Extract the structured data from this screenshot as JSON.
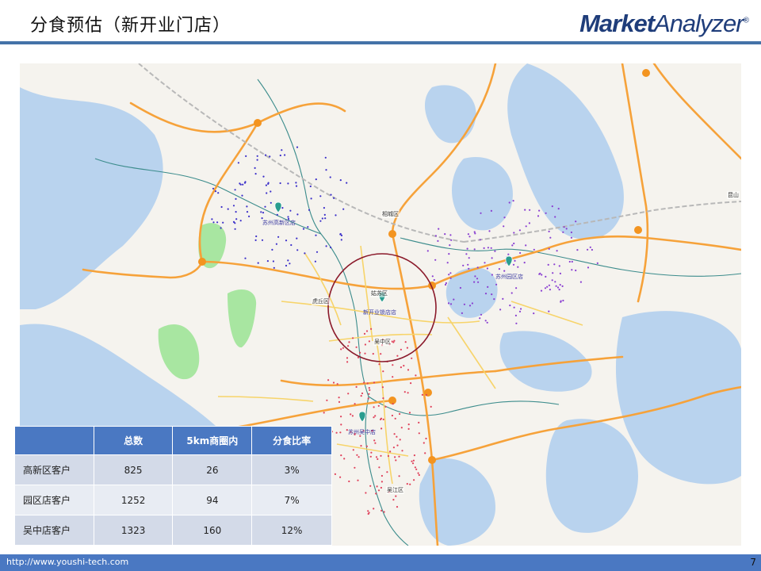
{
  "slide": {
    "title": "分食预估（新开业门店）",
    "logo_bold": "Market",
    "logo_rest": "Analyzer",
    "logo_mark": "®"
  },
  "map": {
    "stores": [
      {
        "label": "苏州高新区店",
        "color": "#2a9d8f"
      },
      {
        "label": "苏州园区店",
        "color": "#2a9d8f"
      },
      {
        "label": "新开业锁店店",
        "color": "#2a9d8f"
      },
      {
        "label": "苏州吴中店",
        "color": "#2a9d8f"
      }
    ],
    "districts": [
      "姑苏区",
      "虎丘区",
      "吴中区",
      "相城区",
      "吴江区",
      "昆山"
    ],
    "colors": {
      "water": "#b9d3ee",
      "land": "#f5f3ee",
      "park": "#a8e6a1",
      "highway": "#f6a23a",
      "arterial": "#f7d46a",
      "boundary": "#3c8c8c",
      "ring": "#8b1a2b",
      "gaoxin_customers": "#3b2fc9",
      "yuanqu_customers": "#8a3fd1",
      "wuzhong_customers": "#e0405a"
    }
  },
  "table": {
    "headers": [
      "",
      "总数",
      "5km商圈内",
      "分食比率"
    ],
    "rows": [
      {
        "name": "高新区客户",
        "total": "825",
        "in5km": "26",
        "ratio": "3%"
      },
      {
        "name": "园区店客户",
        "total": "1252",
        "in5km": "94",
        "ratio": "7%"
      },
      {
        "name": "吴中店客户",
        "total": "1323",
        "in5km": "160",
        "ratio": "12%"
      }
    ]
  },
  "footer": {
    "url": "http://www.youshi-tech.com",
    "page": "7"
  }
}
